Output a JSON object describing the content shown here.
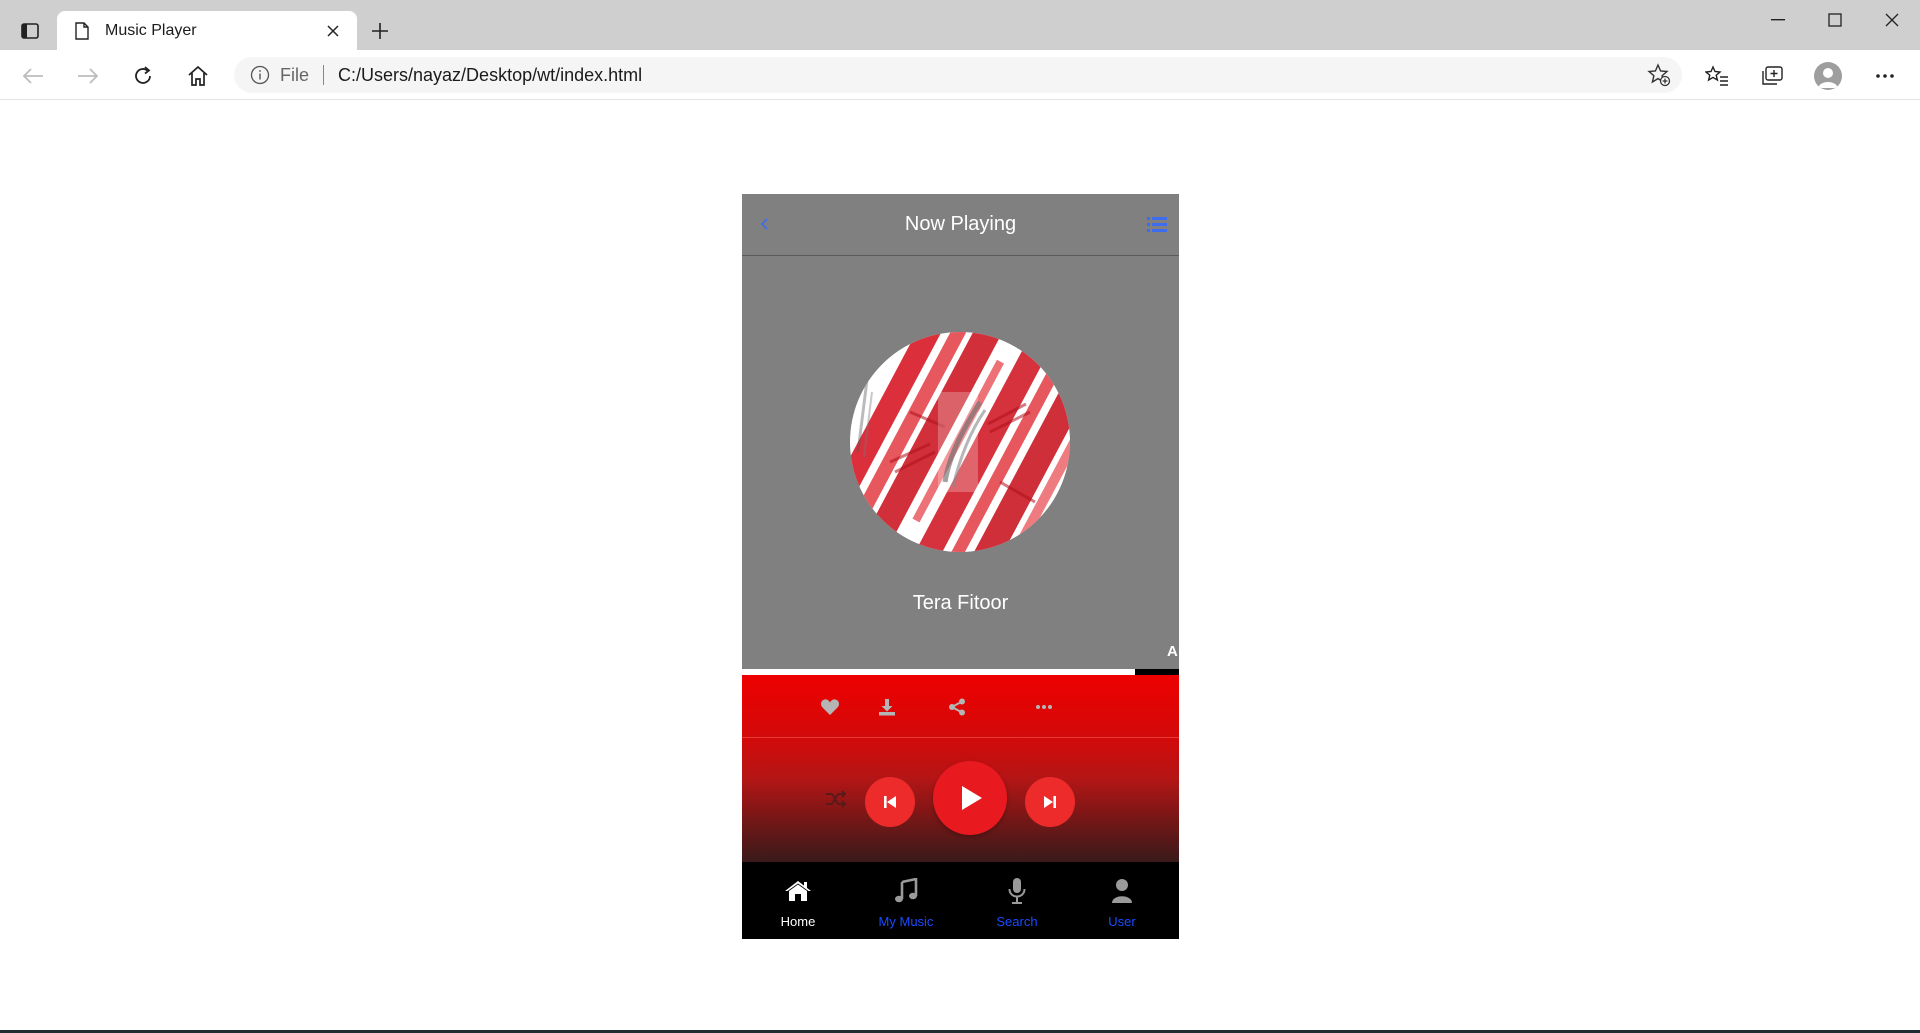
{
  "browser": {
    "tab_title": "Music Player",
    "address_scheme": "File",
    "address_url": "C:/Users/nayaz/Desktop/wt/index.html"
  },
  "player": {
    "header_title": "Now Playing",
    "song_title": "Tera Fitoor",
    "marquee_text": "A",
    "progress": 0.9,
    "nav": [
      {
        "label": "Home",
        "icon": "home-icon",
        "active": true
      },
      {
        "label": "My Music",
        "icon": "music-note-icon",
        "active": false
      },
      {
        "label": "Search",
        "icon": "microphone-icon",
        "active": false
      },
      {
        "label": "User",
        "icon": "user-icon",
        "active": false
      }
    ],
    "colors": {
      "panel": "#808080",
      "accent_red": "#e8191f",
      "nav_blue": "#1a4cff",
      "header_blue": "#3d6cf0"
    }
  }
}
